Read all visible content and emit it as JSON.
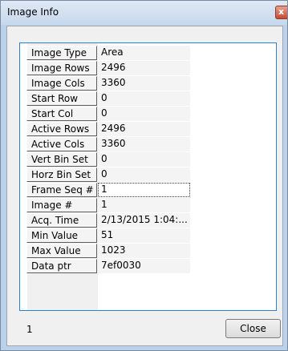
{
  "window": {
    "title": "Image Info",
    "close_glyph": "x"
  },
  "fields": [
    {
      "label": "Image Type",
      "value": "Area"
    },
    {
      "label": "Image Rows",
      "value": "2496"
    },
    {
      "label": "Image Cols",
      "value": "3360"
    },
    {
      "label": "Start Row",
      "value": "0"
    },
    {
      "label": "Start Col",
      "value": "0"
    },
    {
      "label": "Active Rows",
      "value": "2496"
    },
    {
      "label": "Active Cols",
      "value": "3360"
    },
    {
      "label": "Vert Bin Set",
      "value": "0"
    },
    {
      "label": "Horz Bin Set",
      "value": "0"
    },
    {
      "label": "Frame Seq #",
      "value": "1"
    },
    {
      "label": "Image #",
      "value": "1"
    },
    {
      "label": "Acq. Time",
      "value": "2/13/2015 1:04:..."
    },
    {
      "label": "Min Value",
      "value": "51"
    },
    {
      "label": "Max Value",
      "value": "1023"
    },
    {
      "label": "Data ptr",
      "value": "7ef0030"
    }
  ],
  "status": {
    "text": "1"
  },
  "buttons": {
    "close_label": "Close"
  },
  "colors": {
    "title_bar": "#c7d8ec",
    "listbox_border": "#2b7fd6",
    "close_button_red": "#c74a30"
  }
}
